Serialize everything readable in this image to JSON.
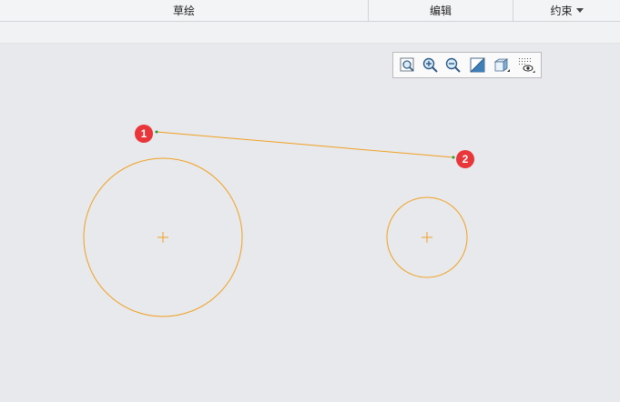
{
  "menubar": {
    "tabs": [
      {
        "label": "草绘"
      },
      {
        "label": "编辑"
      },
      {
        "label": "约束"
      }
    ]
  },
  "view_toolbar": {
    "icons": [
      "zoom-fit-icon",
      "zoom-in-icon",
      "zoom-out-icon",
      "display-style-icon",
      "view-orientation-icon",
      "visibility-filter-icon"
    ]
  },
  "sketch": {
    "stroke_color": "#f0a020",
    "point_color": "#2a9a2a",
    "points": [
      {
        "label": "1"
      },
      {
        "label": "2"
      }
    ]
  },
  "colors": {
    "background": "#e8e9ec",
    "badge": "#e8363a"
  }
}
